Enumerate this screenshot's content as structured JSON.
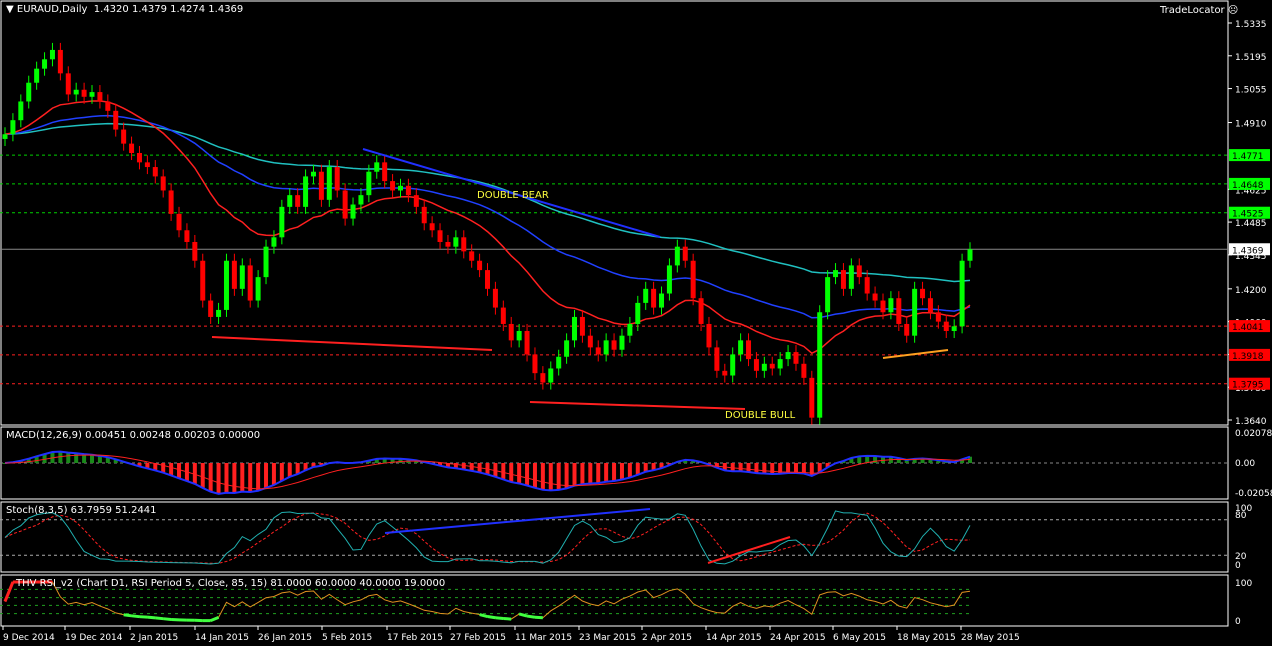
{
  "header": {
    "symbol": "EURAUD,Daily",
    "ohlc": "1.4320 1.4379 1.4274 1.4369",
    "brand": "TradeLocator"
  },
  "indicators": {
    "macd": "MACD(12,26,9) 0.00451 0.00248 0.00203 0.00000",
    "stoch": "Stoch(8,3,5) 63.7959 51.2441",
    "rsi": "THV RSI_v2  (Chart D1,  RSI Period 5,  Close,  85,  15)  81.0000 60.0000 40.0000 19.0000"
  },
  "annotations": {
    "double_bear": "DOUBLE BEAR",
    "double_bull": "DOUBLE BULL"
  },
  "colors": {
    "bull": "#00ff00",
    "bear": "#ff0000",
    "ema_fast": "#ff2020",
    "ema_mid": "#2040ff",
    "ema_slow": "#20c0c0",
    "support": "#ff0000",
    "resistance": "#00ff00"
  },
  "chart_data": {
    "type": "candlestick",
    "title": "EURAUD,Daily",
    "closes": [
      1.486,
      1.492,
      1.5,
      1.508,
      1.514,
      1.518,
      1.522,
      1.512,
      1.503,
      1.505,
      1.502,
      1.504,
      1.5,
      1.496,
      1.488,
      1.482,
      1.478,
      1.474,
      1.472,
      1.468,
      1.462,
      1.452,
      1.445,
      1.44,
      1.432,
      1.415,
      1.408,
      1.411,
      1.432,
      1.42,
      1.43,
      1.415,
      1.425,
      1.438,
      1.442,
      1.455,
      1.46,
      1.455,
      1.468,
      1.47,
      1.458,
      1.472,
      1.462,
      1.45,
      1.456,
      1.46,
      1.47,
      1.474,
      1.466,
      1.462,
      1.464,
      1.46,
      1.455,
      1.448,
      1.445,
      1.44,
      1.438,
      1.442,
      1.436,
      1.432,
      1.428,
      1.42,
      1.412,
      1.405,
      1.398,
      1.402,
      1.392,
      1.384,
      1.38,
      1.386,
      1.391,
      1.398,
      1.408,
      1.4,
      1.395,
      1.392,
      1.398,
      1.394,
      1.4,
      1.405,
      1.414,
      1.42,
      1.412,
      1.418,
      1.43,
      1.438,
      1.432,
      1.416,
      1.405,
      1.395,
      1.385,
      1.383,
      1.392,
      1.398,
      1.39,
      1.385,
      1.388,
      1.386,
      1.39,
      1.393,
      1.388,
      1.382,
      1.365,
      1.41,
      1.425,
      1.428,
      1.42,
      1.43,
      1.425,
      1.418,
      1.415,
      1.41,
      1.416,
      1.405,
      1.4,
      1.42,
      1.416,
      1.41,
      1.406,
      1.402,
      1.404,
      1.432,
      1.4369
    ],
    "date_labels": [
      "9 Dec 2014",
      "19 Dec 2014",
      "2 Jan 2015",
      "14 Jan 2015",
      "26 Jan 2015",
      "5 Feb 2015",
      "17 Feb 2015",
      "27 Feb 2015",
      "11 Mar 2015",
      "23 Mar 2015",
      "2 Apr 2015",
      "14 Apr 2015",
      "24 Apr 2015",
      "6 May 2015",
      "18 May 2015",
      "28 May 2015"
    ],
    "price_ticks": [
      "1.5335",
      "1.5195",
      "1.5055",
      "1.4910",
      "1.4625",
      "1.4485",
      "1.4345",
      "1.4200",
      "1.4060",
      "1.3920",
      "1.3780",
      "1.3640"
    ],
    "ylim": [
      1.364,
      1.5335
    ],
    "resistance_levels": [
      "1.4771",
      "1.4648",
      "1.4525"
    ],
    "support_levels": [
      "1.4041",
      "1.3918",
      "1.3795"
    ],
    "current_price": "1.4369",
    "macd_ticks": [
      "0.02078",
      "0.00",
      "-0.02058"
    ],
    "stoch_ticks": [
      "100",
      "80",
      "20",
      "0"
    ],
    "rsi_ticks": [
      "100",
      "0"
    ]
  }
}
